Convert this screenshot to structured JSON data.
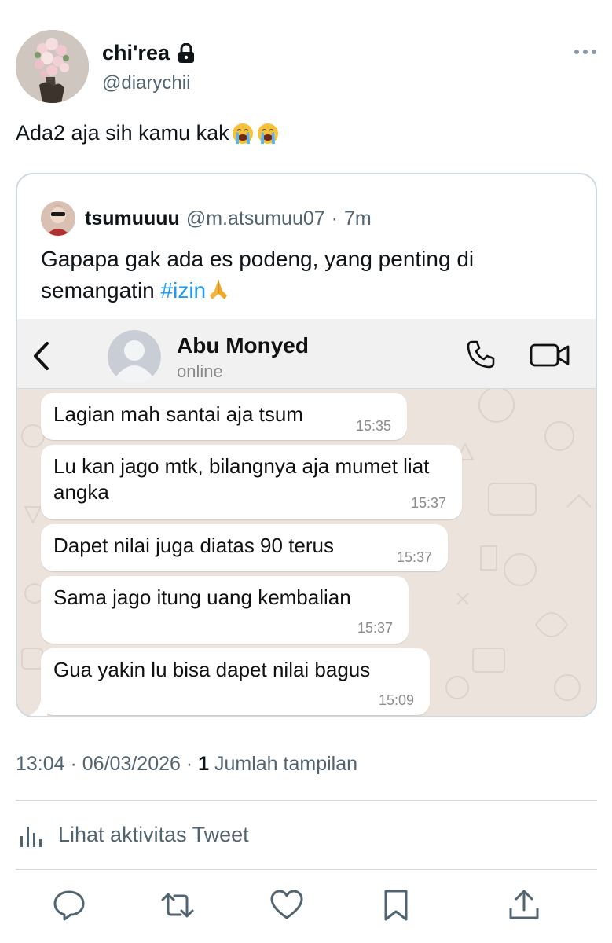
{
  "tweet": {
    "author_name": "chi'rea",
    "author_handle": "@diarychii",
    "text": "Ada2 aja sih kamu kak",
    "emoji": [
      "loudly-crying-face",
      "loudly-crying-face"
    ]
  },
  "quote": {
    "author_name": "tsumuuuu",
    "author_handle": "@m.atsumuu07",
    "separator": "·",
    "time": "7m",
    "text": "Gapapa gak ada es podeng, yang penting di semangatin ",
    "hashtag": "#izin",
    "emoji": "folded-hands"
  },
  "chat": {
    "contact_name": "Abu Monyed",
    "contact_status": "online",
    "messages": [
      {
        "text": "Lagian mah santai aja tsum",
        "time": "15:35"
      },
      {
        "text": "Lu kan jago mtk, bilangnya aja mumet liat angka",
        "time": "15:37"
      },
      {
        "text": "Dapet nilai juga diatas 90 terus",
        "time": "15:37"
      },
      {
        "text": "Sama jago itung uang kembalian",
        "time": "15:37"
      },
      {
        "text": "Gua yakin lu bisa dapet nilai bagus",
        "time": "15:09"
      }
    ]
  },
  "meta": {
    "time": "13:04",
    "sep1": " · ",
    "date": "06/03/2026",
    "sep2": " · ",
    "views_count": "1",
    "views_label": " Jumlah tampilan"
  },
  "activity_label": "Lihat aktivitas Tweet",
  "colors": {
    "link": "#1d9bf0",
    "secondary_text": "#536471",
    "border": "#cfd9de",
    "chat_bg": "#ece4dc"
  }
}
